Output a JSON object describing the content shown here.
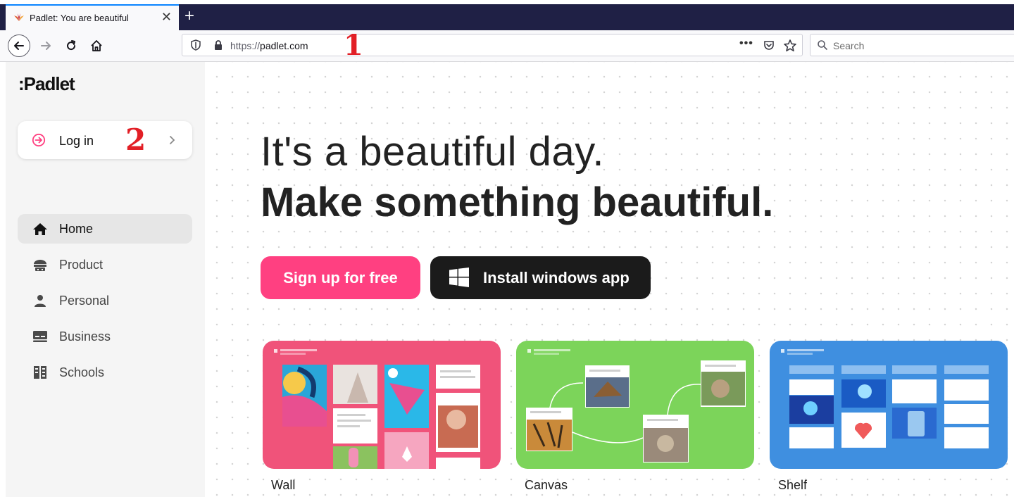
{
  "browser": {
    "tab_title": "Padlet: You are beautiful",
    "url_protocol": "https://",
    "url_domain": "padlet.com",
    "search_placeholder": "Search",
    "tab_close": "✕",
    "new_tab": "+",
    "overflow_menu": "•••"
  },
  "annotations": {
    "one": "1",
    "two": "2"
  },
  "sidebar": {
    "logo": ":Padlet",
    "login_label": "Log in",
    "items": [
      {
        "label": "Home",
        "icon": "home-icon",
        "active": true
      },
      {
        "label": "Product",
        "icon": "product-icon"
      },
      {
        "label": "Personal",
        "icon": "person-icon"
      },
      {
        "label": "Business",
        "icon": "business-icon"
      },
      {
        "label": "Schools",
        "icon": "schools-icon"
      }
    ]
  },
  "hero": {
    "line1": "It's a beautiful day.",
    "line2": "Make something beautiful.",
    "signup_label": "Sign up for free",
    "install_label": "Install windows app"
  },
  "cards": [
    {
      "label": "Wall",
      "color": "#f0537a"
    },
    {
      "label": "Canvas",
      "color": "#7cd45a"
    },
    {
      "label": "Shelf",
      "color": "#3f8fe0"
    }
  ],
  "colors": {
    "brand_pink": "#ff4081",
    "dark_button": "#1b1b1b",
    "annotation_red": "#e21f26",
    "tabbar": "#1f2045"
  }
}
